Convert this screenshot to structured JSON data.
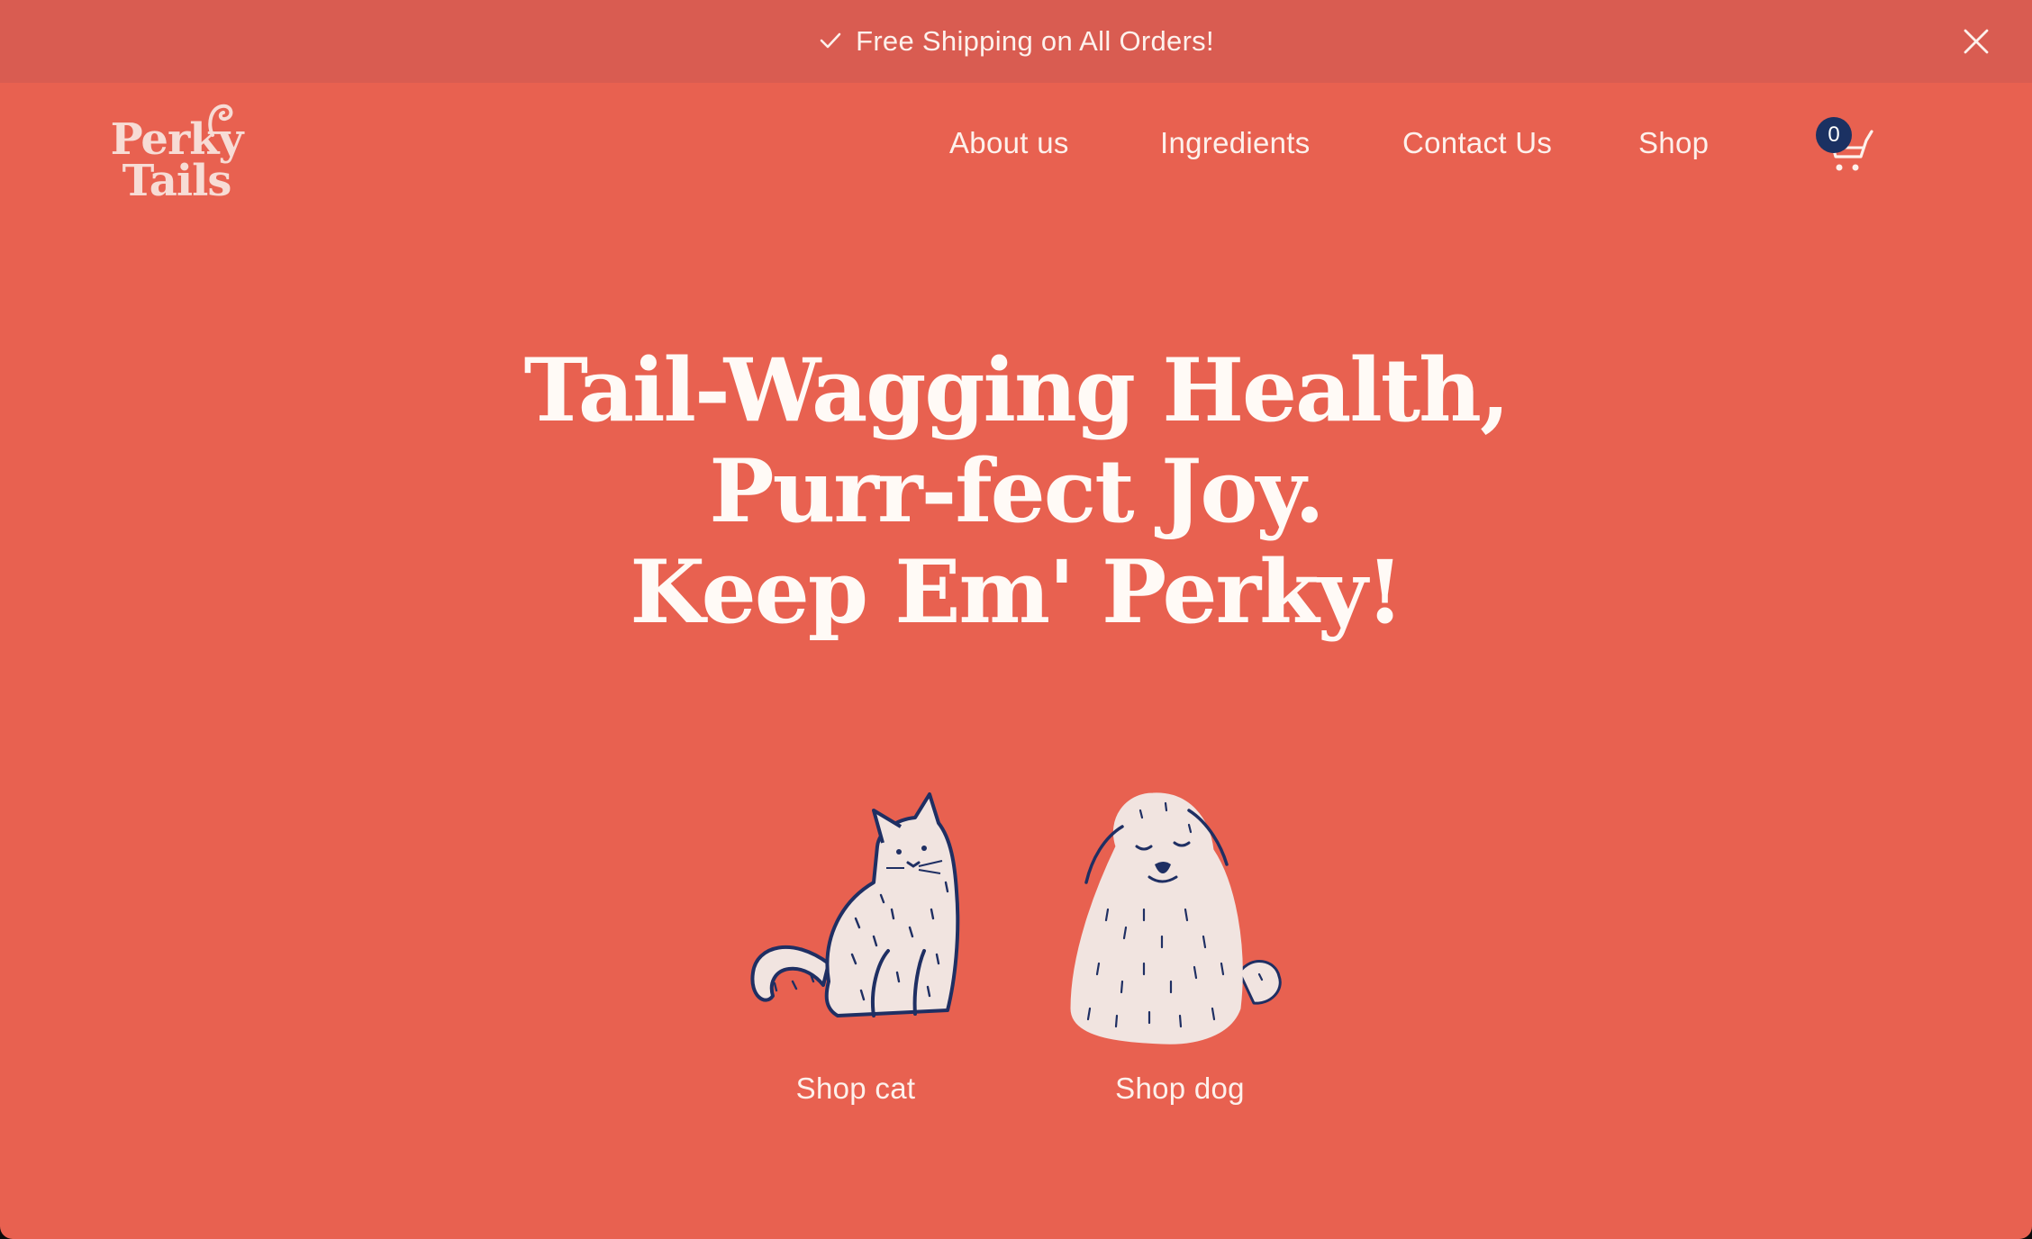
{
  "announcement": {
    "text": "Free Shipping on All Orders!",
    "check_icon": "check-icon",
    "close_icon": "close-icon"
  },
  "brand": {
    "line1": "Perky",
    "line2": "Tails"
  },
  "nav": {
    "items": [
      {
        "label": "About us"
      },
      {
        "label": "Ingredients"
      },
      {
        "label": "Contact Us"
      },
      {
        "label": "Shop"
      }
    ]
  },
  "cart": {
    "icon": "cart-icon",
    "count": "0"
  },
  "hero": {
    "line1": "Tail-Wagging Health,",
    "line2": "Purr-fect Joy.",
    "line3": "Keep Em' Perky!"
  },
  "categories": [
    {
      "label": "Shop cat",
      "icon": "cat-illustration-icon"
    },
    {
      "label": "Shop dog",
      "icon": "dog-illustration-icon"
    }
  ],
  "colors": {
    "background": "#e86150",
    "announcement_bar": "#d95c51",
    "text_light": "#fdf1ec",
    "logo": "#f7dcd5",
    "cart_badge": "#1b3162",
    "illustration_fill": "#f1e4e0",
    "illustration_stroke": "#1f2f63"
  }
}
